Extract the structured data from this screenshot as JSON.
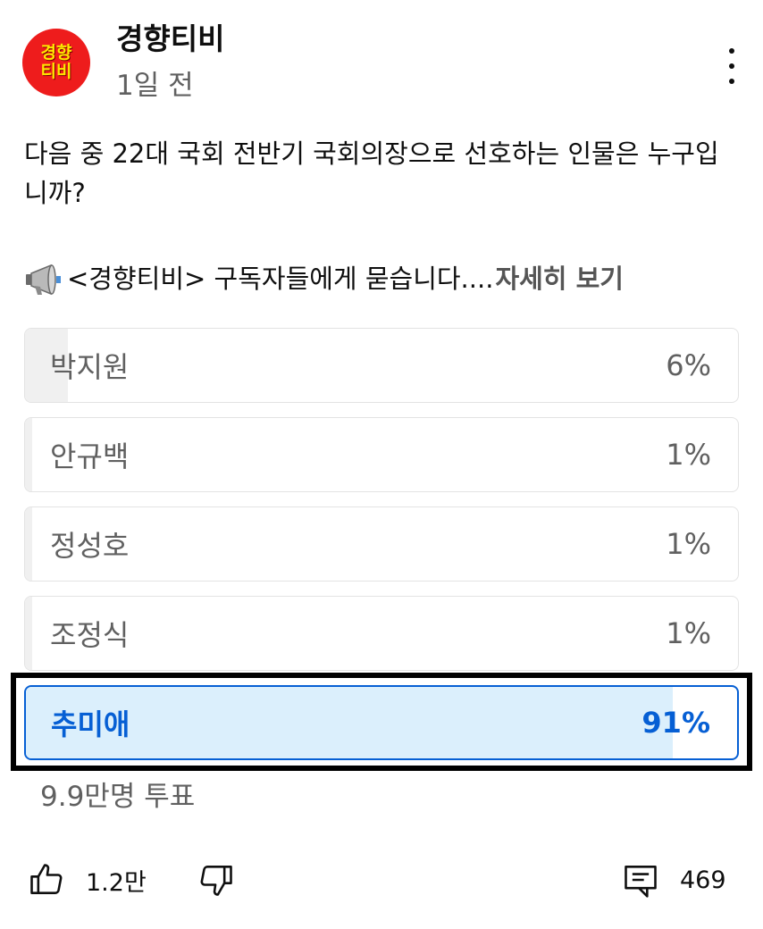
{
  "channel": {
    "avatar_text_line1": "경향",
    "avatar_text_line2": "티비",
    "name": "경향티비",
    "time": "1일 전"
  },
  "post": {
    "question": "다음 중 22대 국회 전반기 국회의장으로 선호하는 인물은 누구입니까?",
    "subtitle": "<경향티비> 구독자들에게 묻습니다....",
    "more_label": "자세히 보기",
    "subtitle_icon": "megaphone-icon"
  },
  "poll": {
    "options": [
      {
        "label": "박지원",
        "percent_text": "6%",
        "percent": 6,
        "selected": false
      },
      {
        "label": "안규백",
        "percent_text": "1%",
        "percent": 1,
        "selected": false
      },
      {
        "label": "정성호",
        "percent_text": "1%",
        "percent": 1,
        "selected": false
      },
      {
        "label": "조정식",
        "percent_text": "1%",
        "percent": 1,
        "selected": false
      },
      {
        "label": "추미애",
        "percent_text": "91%",
        "percent": 91,
        "selected": true
      }
    ],
    "vote_count": "9.9만명 투표"
  },
  "actions": {
    "like_count": "1.2만",
    "comment_count": "469",
    "icons": [
      "thumbs-up-icon",
      "thumbs-down-icon",
      "comment-icon",
      "more-vert-icon"
    ]
  },
  "colors": {
    "accent": "#065fd4",
    "selected_fill": "#dbeffc",
    "bar_fill": "#f0f0f0",
    "avatar_bg": "#ee1c1c",
    "avatar_text": "#ffe600"
  }
}
